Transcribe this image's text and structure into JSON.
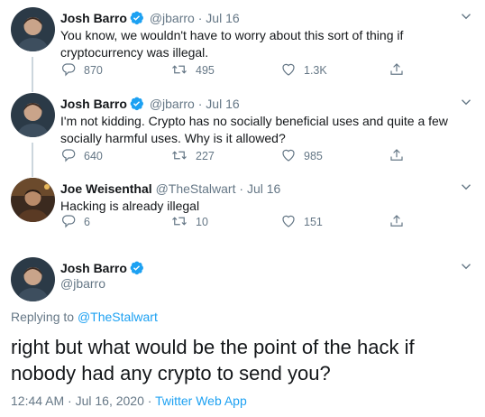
{
  "colors": {
    "verified": "#1da1f2",
    "link": "#1da1f2",
    "muted": "#657786",
    "line": "#ccd6dd"
  },
  "tweets": [
    {
      "name": "Josh Barro",
      "handle": "@jbarro",
      "dot": "·",
      "date": "Jul 16",
      "text": "You know, we wouldn't have to worry about this sort of thing if cryptocurrency was illegal.",
      "replies": "870",
      "retweets": "495",
      "likes": "1.3K",
      "icons": [
        "reply-icon",
        "retweet-icon",
        "like-icon",
        "share-icon"
      ]
    },
    {
      "name": "Josh Barro",
      "handle": "@jbarro",
      "dot": "·",
      "date": "Jul 16",
      "text": "I'm not kidding. Crypto has no socially beneficial uses and quite a few socially harmful uses. Why is it allowed?",
      "replies": "640",
      "retweets": "227",
      "likes": "985"
    },
    {
      "name": "Joe Weisenthal",
      "handle": "@TheStalwart",
      "dot": "·",
      "date": "Jul 16",
      "text": "Hacking is already illegal",
      "replies": "6",
      "retweets": "10",
      "likes": "151"
    }
  ],
  "main": {
    "name": "Josh Barro",
    "handle": "@jbarro",
    "replying_prefix": "Replying to",
    "replying_to": "@TheStalwart",
    "text": "right but what would be the point of the hack if nobody had any crypto to send you?",
    "time": "12:44 AM · Jul 16, 2020",
    "dot": "·",
    "source": "Twitter Web App"
  }
}
